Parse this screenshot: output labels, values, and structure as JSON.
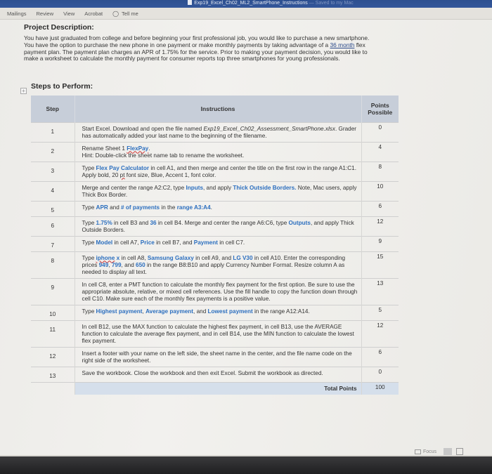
{
  "window": {
    "title": "Exp19_Excel_Ch02_ML2_SmartPhone_Instructions",
    "save_status": "— Saved to my Mac"
  },
  "ribbon": {
    "tabs": [
      "Mailings",
      "Review",
      "View",
      "Acrobat"
    ],
    "tell_me": "Tell me",
    "tell_me_icon": "lightbulb-icon"
  },
  "document": {
    "project_heading": "Project Description:",
    "description_pre": "You have just graduated from college and before beginning your first professional job, you would like to purchase a new smartphone. You have the option to purchase the new phone in one payment or make monthly payments by taking advantage of a ",
    "description_link": "36 month",
    "description_post": " flex payment plan. The payment plan charges an APR of 1.75% for the service. Prior to making your payment decision, you would like to make a worksheet to calculate the monthly payment for consumer reports top three smartphones for young professionals.",
    "steps_heading": "Steps to Perform:",
    "table": {
      "headers": {
        "step": "Step",
        "instructions": "Instructions",
        "points": "Points Possible"
      },
      "rows": [
        {
          "step": "1",
          "points": "0",
          "segments": [
            {
              "t": "Start Excel. Download and open the file named "
            },
            {
              "t": "Exp19_Excel_Ch02_Assessment_SmartPhone.xlsx",
              "s": "it"
            },
            {
              "t": ". Grader has automatically added your last name to the beginning of the filename."
            }
          ]
        },
        {
          "step": "2",
          "points": "4",
          "segments": [
            {
              "t": "Rename Sheet 1 "
            },
            {
              "t": "FlexPay",
              "s": "hl sq"
            },
            {
              "t": ".\nHint: Double-click the sheet name tab to rename the worksheet."
            }
          ]
        },
        {
          "step": "3",
          "points": "8",
          "segments": [
            {
              "t": "Type "
            },
            {
              "t": "Flex Pay Calculator",
              "s": "hl"
            },
            {
              "t": " in cell A1, and then merge and center the title on the first row in the range A1:C1. Apply bold, 20 "
            },
            {
              "t": "pt",
              "s": "sq"
            },
            {
              "t": " font size, Blue, Accent 1, font color."
            }
          ]
        },
        {
          "step": "4",
          "points": "10",
          "segments": [
            {
              "t": "Merge and center the range A2:C2, type "
            },
            {
              "t": "Inputs",
              "s": "hl"
            },
            {
              "t": ", and apply "
            },
            {
              "t": "Thick Outside Borders.",
              "s": "hl"
            },
            {
              "t": " Note, Mac users, apply Thick Box Border."
            }
          ]
        },
        {
          "step": "5",
          "points": "6",
          "segments": [
            {
              "t": "Type "
            },
            {
              "t": "APR",
              "s": "hl"
            },
            {
              "t": " and "
            },
            {
              "t": "# of payments",
              "s": "hl"
            },
            {
              "t": " in the "
            },
            {
              "t": "range A3:A4",
              "s": "hl"
            },
            {
              "t": "."
            }
          ]
        },
        {
          "step": "6",
          "points": "12",
          "segments": [
            {
              "t": "Type "
            },
            {
              "t": "1.75%",
              "s": "hl"
            },
            {
              "t": " in cell B3 and "
            },
            {
              "t": "36",
              "s": "hl"
            },
            {
              "t": " in cell B4. Merge and center the range A6:C6, type "
            },
            {
              "t": "Outputs",
              "s": "hl"
            },
            {
              "t": ", and apply Thick Outside Borders."
            }
          ]
        },
        {
          "step": "7",
          "points": "9",
          "segments": [
            {
              "t": "Type "
            },
            {
              "t": "Model",
              "s": "hl"
            },
            {
              "t": " in cell A7, "
            },
            {
              "t": "Price",
              "s": "hl"
            },
            {
              "t": " in cell B7, and "
            },
            {
              "t": "Payment",
              "s": "hl"
            },
            {
              "t": " in cell C7."
            }
          ]
        },
        {
          "step": "8",
          "points": "15",
          "segments": [
            {
              "t": "Type "
            },
            {
              "t": "iphone",
              "s": "hl sq"
            },
            {
              "t": " x",
              "s": "hl"
            },
            {
              "t": " in cell A8, "
            },
            {
              "t": "Samsung Galaxy",
              "s": "hl"
            },
            {
              "t": " in cell A9, and "
            },
            {
              "t": "LG V30",
              "s": "hl"
            },
            {
              "t": " in cell A10. Enter the corresponding prices "
            },
            {
              "t": "949",
              "s": "hl"
            },
            {
              "t": ", "
            },
            {
              "t": "799",
              "s": "hl"
            },
            {
              "t": ", and "
            },
            {
              "t": "650",
              "s": "hl"
            },
            {
              "t": " in the range B8:B10 and apply Currency Number Format. Resize column A as needed to display all text."
            }
          ]
        },
        {
          "step": "9",
          "points": "13",
          "segments": [
            {
              "t": "In cell C8, enter a PMT function to calculate the monthly flex payment for the first option. Be sure to use the appropriate absolute, relative, or mixed cell references. Use the fill handle to copy the function down through cell C10. Make sure each of the monthly flex payments is a positive value."
            }
          ]
        },
        {
          "step": "10",
          "points": "5",
          "segments": [
            {
              "t": "Type "
            },
            {
              "t": "Highest payment",
              "s": "hl"
            },
            {
              "t": ", "
            },
            {
              "t": "Average payment",
              "s": "hl"
            },
            {
              "t": ", and "
            },
            {
              "t": "Lowest payment",
              "s": "hl"
            },
            {
              "t": " in the range A12:A14."
            }
          ]
        },
        {
          "step": "11",
          "points": "12",
          "segments": [
            {
              "t": "In cell B12, use the MAX function to calculate the highest flex payment, in cell B13, use the AVERAGE function to calculate the average flex payment, and in cell B14, use the MIN function to calculate the lowest flex payment."
            }
          ]
        },
        {
          "step": "12",
          "points": "6",
          "segments": [
            {
              "t": "Insert a footer with your name on the left side, the sheet name in the center, and the file name code on the right side of the worksheet."
            }
          ]
        },
        {
          "step": "13",
          "points": "0",
          "segments": [
            {
              "t": "Save the workbook. Close the workbook and then exit Excel. Submit the workbook as directed."
            }
          ]
        }
      ],
      "total_label": "Total Points",
      "total_value": "100"
    }
  },
  "status_bar": {
    "focus_label": "Focus"
  }
}
